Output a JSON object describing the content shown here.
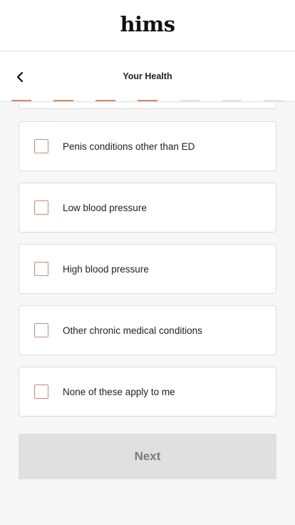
{
  "header": {
    "logo": "hims"
  },
  "topbar": {
    "title": "Your Health",
    "back_icon": "chevron-left-icon"
  },
  "progress": {
    "total_steps": 7,
    "completed_steps": 4,
    "done_color": "#c58e78",
    "todo_color": "#e4e4e4"
  },
  "options": [
    {
      "label": "Penis conditions other than ED",
      "checked": false
    },
    {
      "label": "Low blood pressure",
      "checked": false
    },
    {
      "label": "High blood pressure",
      "checked": false
    },
    {
      "label": "Other chronic medical conditions",
      "checked": false
    },
    {
      "label": "None of these apply to me",
      "checked": false
    }
  ],
  "next_button": {
    "label": "Next",
    "disabled": true
  },
  "colors": {
    "accent": "#c58e78",
    "button_disabled": "#e0e0e0",
    "background": "#f7f7f7"
  }
}
